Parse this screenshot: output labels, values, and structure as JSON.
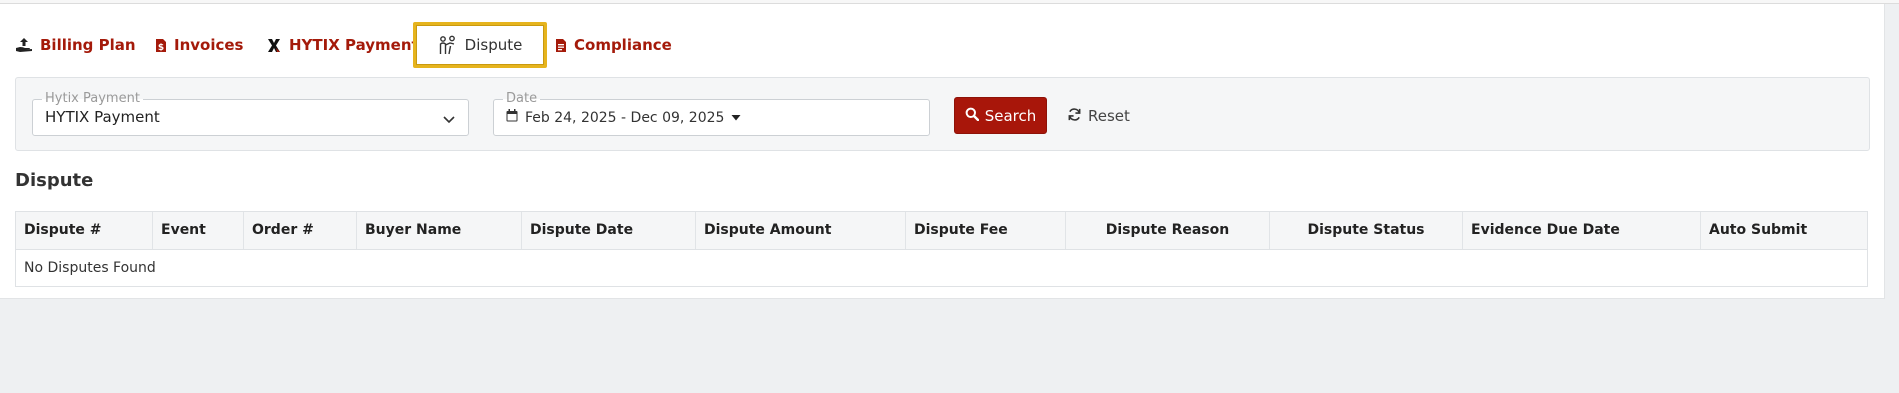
{
  "tabs": [
    {
      "label": "Billing Plan",
      "icon": "hand-upload-icon"
    },
    {
      "label": "Invoices",
      "icon": "file-dollar-icon"
    },
    {
      "label": "HYTIX Payment",
      "icon": "hytix-x-icon"
    },
    {
      "label": "Dispute",
      "icon": "people-dispute-icon",
      "active": true
    },
    {
      "label": "Compliance",
      "icon": "file-pdf-icon"
    }
  ],
  "filters": {
    "payment": {
      "legend": "Hytix Payment",
      "value": "HYTIX Payment"
    },
    "date": {
      "legend": "Date",
      "value": "Feb 24, 2025 - Dec 09, 2025"
    },
    "search_label": "Search",
    "reset_label": "Reset"
  },
  "section": {
    "title": "Dispute"
  },
  "table": {
    "columns": [
      "Dispute #",
      "Event",
      "Order #",
      "Buyer Name",
      "Dispute Date",
      "Dispute Amount",
      "Dispute Fee",
      "Dispute Reason",
      "Dispute Status",
      "Evidence Due Date",
      "Auto Submit"
    ],
    "empty_message": "No Disputes Found"
  },
  "colors": {
    "brand": "#a8160a",
    "active_tab_border": "#e6b41e",
    "panel_bg": "#f5f6f7"
  }
}
